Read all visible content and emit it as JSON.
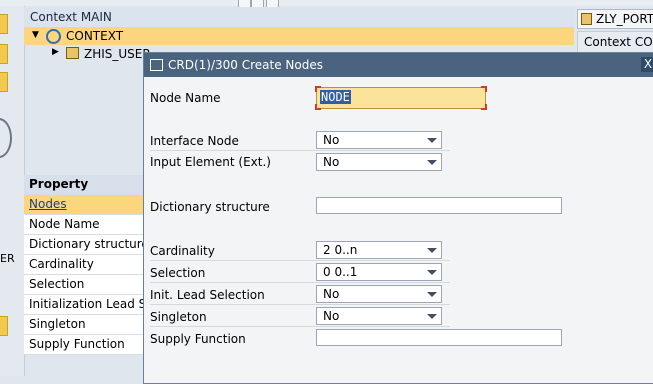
{
  "context_panel": {
    "header": "Context MAIN",
    "root_node": "CONTEXT",
    "child_node": "ZHIS_USER"
  },
  "right_panel": {
    "button_label": "ZLY_PORT",
    "tab_label": "Context COM"
  },
  "left_margin": {
    "text": "ER"
  },
  "property_table": {
    "header": "Property",
    "rows": [
      "Nodes",
      "Node Name",
      "Dictionary structure",
      "Cardinality",
      "Selection",
      "Initialization Lead Sel",
      "Singleton",
      "Supply Function"
    ],
    "selected_index": 0
  },
  "dialog": {
    "title": "CRD(1)/300 Create Nodes",
    "close_glyph": "X",
    "fields": {
      "node_name": {
        "label": "Node Name",
        "value": "NODE"
      },
      "interface_node": {
        "label": "Interface Node",
        "value": "No"
      },
      "input_element": {
        "label": "Input Element (Ext.)",
        "value": "No"
      },
      "dictionary_structure": {
        "label": "Dictionary structure",
        "value": ""
      },
      "cardinality": {
        "label": "Cardinality",
        "value": "2 0..n"
      },
      "selection": {
        "label": "Selection",
        "value": "0 0..1"
      },
      "init_lead_selection": {
        "label": "Init. Lead Selection",
        "value": "No"
      },
      "singleton": {
        "label": "Singleton",
        "value": "No"
      },
      "supply_function": {
        "label": "Supply Function",
        "value": ""
      }
    }
  },
  "colors": {
    "dialog_title_bar": "#4a6480",
    "selection_highlight": "#fbd67d",
    "input_focus": "#fbe39a"
  }
}
